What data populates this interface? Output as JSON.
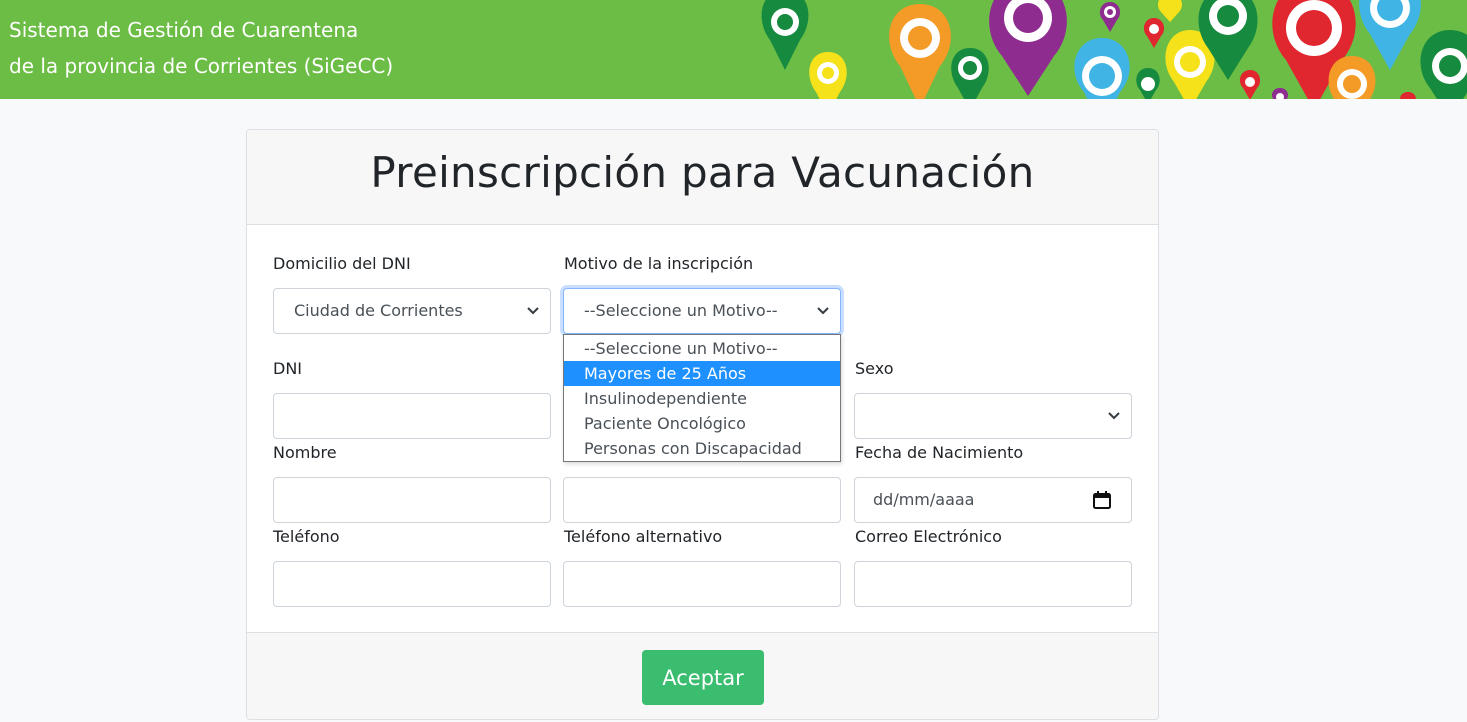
{
  "header": {
    "title_line1": "Sistema de Gestión de Cuarentena",
    "title_line2": "de la provincia de Corrientes (SiGeCC)",
    "banner_icon": "map-pins-banner",
    "bg_color": "#6cbd45"
  },
  "form": {
    "title": "Preinscripción para Vacunación",
    "domicilio": {
      "label": "Domicilio del DNI",
      "value": "Ciudad de Corrientes"
    },
    "motivo": {
      "label": "Motivo de la inscripción",
      "value": "--Seleccione un Motivo--",
      "options": [
        "--Seleccione un Motivo--",
        "Mayores de 25 Años",
        "Insulinodependiente",
        "Paciente Oncológico",
        "Personas con Discapacidad"
      ],
      "highlighted": "Mayores de 25 Años"
    },
    "dni": {
      "label": "DNI",
      "value": ""
    },
    "sexo": {
      "label": "Sexo",
      "value": ""
    },
    "nombre": {
      "label": "Nombre",
      "value": ""
    },
    "apellido": {
      "value": ""
    },
    "fecha_nacimiento": {
      "label": "Fecha de Nacimiento",
      "placeholder": "dd/mm/aaaa"
    },
    "telefono": {
      "label": "Teléfono",
      "value": ""
    },
    "telefono_alt": {
      "label": "Teléfono alternativo",
      "value": ""
    },
    "correo": {
      "label": "Correo Electrónico",
      "value": ""
    },
    "submit_label": "Aceptar"
  },
  "colors": {
    "accent_button": "#3bbd6f",
    "option_highlight": "#1e90ff",
    "page_bg": "#f8f9fa"
  }
}
